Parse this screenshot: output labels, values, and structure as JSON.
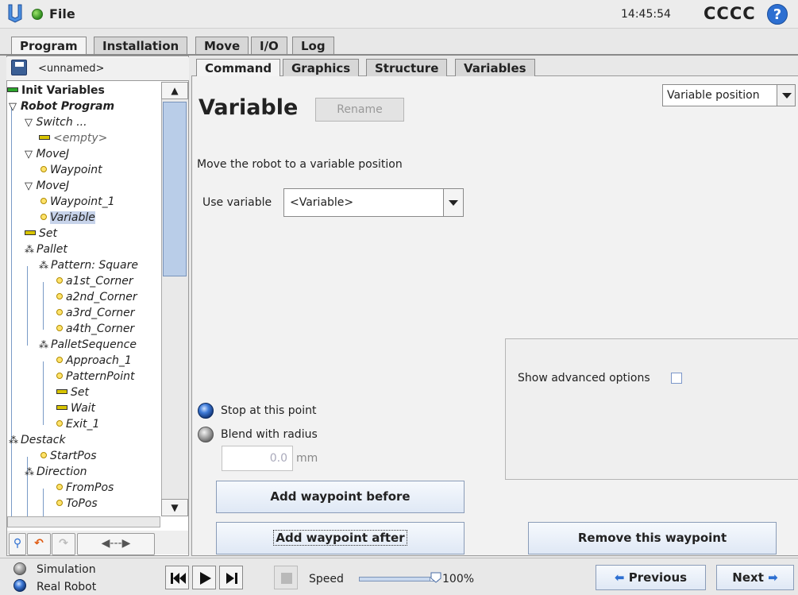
{
  "topbar": {
    "file_label": "File",
    "time": "14:45:54",
    "robot_name": "CCCC",
    "help_glyph": "?"
  },
  "main_tabs": [
    "Program",
    "Installation",
    "Move",
    "I/O",
    "Log"
  ],
  "program": {
    "name": "<unnamed>"
  },
  "sub_tabs": [
    "Command",
    "Graphics",
    "Structure",
    "Variables"
  ],
  "tree": [
    {
      "label": "Init Variables",
      "icon": "dash-green",
      "style": "bold"
    },
    {
      "label": "Robot Program",
      "icon": "triangle-down",
      "style": "bold-italic"
    },
    {
      "label": "Switch ...",
      "icon": "triangle-down"
    },
    {
      "label": "<empty>",
      "icon": "dash-yellow"
    },
    {
      "label": "MoveJ",
      "icon": "triangle-down"
    },
    {
      "label": "Waypoint",
      "icon": "waypoint-dot"
    },
    {
      "label": "MoveJ",
      "icon": "triangle-down"
    },
    {
      "label": "Waypoint_1",
      "icon": "waypoint-dot"
    },
    {
      "label": "Variable",
      "icon": "waypoint-dot",
      "selected": true
    },
    {
      "label": "Set",
      "icon": "dash-yellow"
    },
    {
      "label": "Pallet",
      "icon": "pallet"
    },
    {
      "label": "Pattern: Square",
      "icon": "pallet"
    },
    {
      "label": "a1st_Corner",
      "icon": "waypoint-dot"
    },
    {
      "label": "a2nd_Corner",
      "icon": "waypoint-dot"
    },
    {
      "label": "a3rd_Corner",
      "icon": "waypoint-dot"
    },
    {
      "label": "a4th_Corner",
      "icon": "waypoint-dot"
    },
    {
      "label": "PalletSequence",
      "icon": "pallet"
    },
    {
      "label": "Approach_1",
      "icon": "waypoint-dot"
    },
    {
      "label": "PatternPoint",
      "icon": "waypoint-dot"
    },
    {
      "label": "Set",
      "icon": "dash-yellow"
    },
    {
      "label": "Wait",
      "icon": "dash-yellow"
    },
    {
      "label": "Exit_1",
      "icon": "waypoint-dot"
    },
    {
      "label": "Destack",
      "icon": "pallet"
    },
    {
      "label": "StartPos",
      "icon": "waypoint-dot"
    },
    {
      "label": "Direction",
      "icon": "pallet"
    },
    {
      "label": "FromPos",
      "icon": "waypoint-dot"
    },
    {
      "label": "ToPos",
      "icon": "waypoint-dot"
    }
  ],
  "command": {
    "title": "Variable",
    "rename_label": "Rename",
    "type_select": "Variable position",
    "description": "Move the robot to a variable position",
    "use_variable_label": "Use variable",
    "use_variable_value": "<Variable>",
    "advanced_label": "Show advanced options",
    "stop_label": "Stop at this point",
    "blend_label": "Blend with radius",
    "blend_radius": "0.0",
    "blend_unit": "mm",
    "add_before": "Add waypoint before",
    "add_after": "Add waypoint after",
    "remove": "Remove this waypoint"
  },
  "bottombar": {
    "simulation_label": "Simulation",
    "real_robot_label": "Real Robot",
    "speed_label": "Speed",
    "speed_value": "100%",
    "speed_fraction": 1.0,
    "previous_label": "Previous",
    "next_label": "Next"
  },
  "colors": {
    "accent_blue": "#2d6fd1",
    "selection": "#c7d3ea",
    "status_green": "#2e8b1e"
  }
}
